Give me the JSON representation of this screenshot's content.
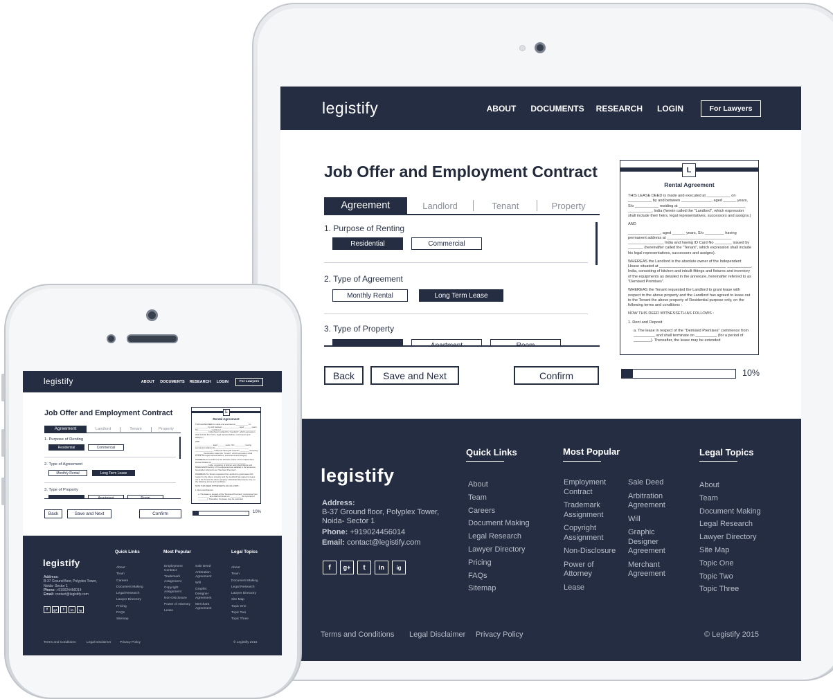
{
  "brand": {
    "logo": "legistify"
  },
  "nav": {
    "items": [
      "ABOUT",
      "DOCUMENTS",
      "RESEARCH",
      "LOGIN"
    ],
    "cta": "For Lawyers"
  },
  "form": {
    "title": "Job Offer and Employment Contract",
    "tabs": [
      "Agreement",
      "Landlord",
      "Tenant",
      "Property"
    ],
    "q1": {
      "label": "1. Purpose of Renting",
      "options": [
        "Residential",
        "Commercial"
      ],
      "selected": "Residential"
    },
    "q2": {
      "label": "2. Type of Agreement",
      "options": [
        "Monthly Rental",
        "Long Term Lease"
      ],
      "selected": "Long Term Lease"
    },
    "q3": {
      "label": "3. Type of Property",
      "options": [
        "",
        "Apartment",
        "Room"
      ]
    },
    "buttons": {
      "back": "Back",
      "save_next": "Save and Next",
      "confirm": "Confirm"
    }
  },
  "preview": {
    "badge": "L",
    "title": "Rental Agreement",
    "paragraphs": [
      "THIS LEASE DEED is made and executed at ___________ on ___________ by and between ______________, aged ______ years, S/o ___________ residing at _______________________________ ___________, India (herein called the \"Landlord\", which expression shall include their heirs, legal representatives, successors and assigns.)",
      "AND",
      "_______________, aged ______ years, S/o _________ having permanent address at ______________________________ ________________, India and having ID Card No ________ issued by _______ (hereinafter called the \"Tenant\", which expression shall include his legal representatives, successors and assigns).",
      "WHEREAS the Landlord is the absolute owner of the Independent House situated at _______________________________ ___________, India, consisting of kitchen and inbuilt fittings and fixtures and inventory of the equipments as detailed in the annexure, hereinafter referred to as \"Demised Premises\".",
      "WHEREAS the Tenant requested the Landlord to grant lease with respect to the above property and the Landlord has agreed to lease out to the Tenant the above property of Residential purpose only, on the following terms and conditions :",
      "NOW THIS DEED WITNESSETH AS FOLLOWS :",
      "1. Rent and Deposit",
      "a. The lease in respect of the \"Demised Premises\" commence from __________ and shall terminate on __________ (for a period of ________). Thereafter, the lease may be extended"
    ],
    "progress_label": "10%",
    "progress_value": 0.1
  },
  "footer": {
    "logo": "legistify",
    "address_label": "Address:",
    "address": "B-37 Ground floor, Polyplex Tower, Noida- Sector 1",
    "phone_label": "Phone:",
    "phone": "+919024456014",
    "email_label": "Email:",
    "email": "contact@legistify.com",
    "quick_links_title": "Quick Links",
    "quick_links": [
      "About",
      "Team",
      "Careers",
      "Document Making",
      "Legal Research",
      "Lawyer Directory",
      "Pricing",
      "FAQs",
      "Sitemap"
    ],
    "popular_title": "Most Popular",
    "popular_col1": [
      "Employment Contract",
      "Trademark Assignment",
      "Copyright Assignment",
      "Non-Disclosure",
      "Power of Attorney",
      "Lease"
    ],
    "popular_col2": [
      "Sale  Deed",
      "Arbitration Agreement",
      "Will",
      "Graphic Designer Agreement",
      "Merchant Agreement"
    ],
    "topics_title": "Legal Topics",
    "topics": [
      "About",
      "Team",
      "Document Making",
      "Legal Research",
      "Lawyer Directory",
      "Site Map",
      "Topic One",
      "Topic Two",
      "Topic Three"
    ],
    "social": [
      "f",
      "g+",
      "t",
      "in",
      "ig"
    ],
    "bottom_links": [
      "Terms and Conditions",
      "Legal Disclaimer",
      "Privacy Policy"
    ],
    "copyright": "©  Legistify 2015"
  }
}
